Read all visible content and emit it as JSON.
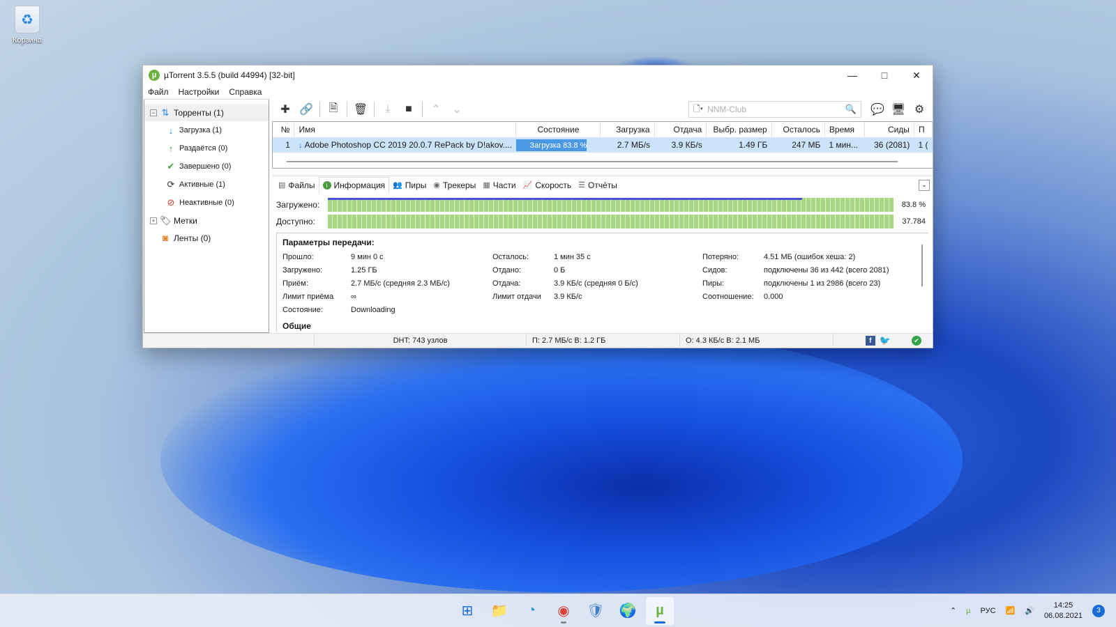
{
  "desktop": {
    "recycle_bin_label": "Корзина"
  },
  "window": {
    "title": "µTorrent 3.5.5  (build 44994) [32-bit]",
    "logo": "µ",
    "controls": [
      "minimize-icon",
      "maximize-icon",
      "close-icon"
    ]
  },
  "menu": {
    "file": "Файл",
    "settings": "Настройки",
    "help": "Справка"
  },
  "sidebar": {
    "torrents": "Торренты (1)",
    "downloading": "Загрузка (1)",
    "seeding": "Раздаётся (0)",
    "completed": "Завершено (0)",
    "active": "Активные (1)",
    "inactive": "Неактивные (0)",
    "labels": "Метки",
    "feeds": "Ленты (0)"
  },
  "toolbar": {
    "search_placeholder": "NNM-Club",
    "icons": [
      "add-icon",
      "link-icon",
      "create-icon",
      "delete-icon",
      "download-icon",
      "stop-icon",
      "up-icon",
      "down-icon",
      "chat-icon",
      "remote-icon",
      "settings-icon"
    ]
  },
  "torrent_table": {
    "headers": [
      "№",
      "Имя",
      "Состояние",
      "Загрузка",
      "Отдача",
      "Выбр. размер",
      "Осталось",
      "Время",
      "Сиды",
      "П"
    ],
    "row": {
      "num": "1",
      "name": "Adobe Photoshop CC 2019 20.0.7 RePack by D!akov....",
      "status": "Загрузка 83.8 %",
      "status_progress": 0.838,
      "down": "2.7 МБ/s",
      "up": "3.9 КБ/s",
      "size": "1.49 ГБ",
      "remaining": "247 МБ",
      "time": "1 мин...",
      "seeds": "36 (2081)",
      "peers": "1 ("
    }
  },
  "tabs": [
    "Файлы",
    "Информация",
    "Пиры",
    "Трекеры",
    "Части",
    "Скорость",
    "Отчёты"
  ],
  "bars": {
    "downloaded_label": "Загружено:",
    "downloaded_value": "83.8 %",
    "downloaded_progress": 0.838,
    "available_label": "Доступно:",
    "available_value": "37.784"
  },
  "params": {
    "heading": "Параметры передачи:",
    "elapsed_label": "Прошло:",
    "elapsed": "9 мин 0 с",
    "remaining_label": "Осталось:",
    "remaining": "1 мин 35 с",
    "wasted_label": "Потеряно:",
    "wasted": "4.51 МБ (ошибок хеша: 2)",
    "downloaded_label": "Загружено:",
    "downloaded": "1.25 ГБ",
    "uploaded_label": "Отдано:",
    "uploaded": "0 Б",
    "seeds_label": "Сидов:",
    "seeds": "подключены 36 из 442 (всего 2081)",
    "dl_speed_label": "Приём:",
    "dl_speed": "2.7 МБ/с (средняя 2.3 МБ/с)",
    "ul_speed_label": "Отдача:",
    "ul_speed": "3.9 КБ/с (средняя 0 Б/с)",
    "peers_label": "Пиры:",
    "peers": "подключены 1 из 2986 (всего 23)",
    "dl_limit_label": "Лимит приёма",
    "dl_limit": "∞",
    "ul_limit_label": "Лимит отдачи",
    "ul_limit": "3.9 КБ/с",
    "ratio_label": "Соотношение:",
    "ratio": "0.000",
    "state_label": "Состояние:",
    "state": "Downloading",
    "general_heading": "Общие"
  },
  "statusbar": {
    "dht": "DHT: 743 узлов",
    "down": "П: 2.7 МБ/с В: 1.2 ГБ",
    "up": "О: 4.3 КБ/с В: 2.1 МБ"
  },
  "taskbar": {
    "apps": [
      "start-icon",
      "explorer-icon",
      "edge-icon",
      "chrome-icon",
      "app-icon",
      "earth-icon",
      "utorrent-icon"
    ],
    "lang": "РУС",
    "time": "14:25",
    "date": "06.08.2021",
    "notifications": "3"
  }
}
